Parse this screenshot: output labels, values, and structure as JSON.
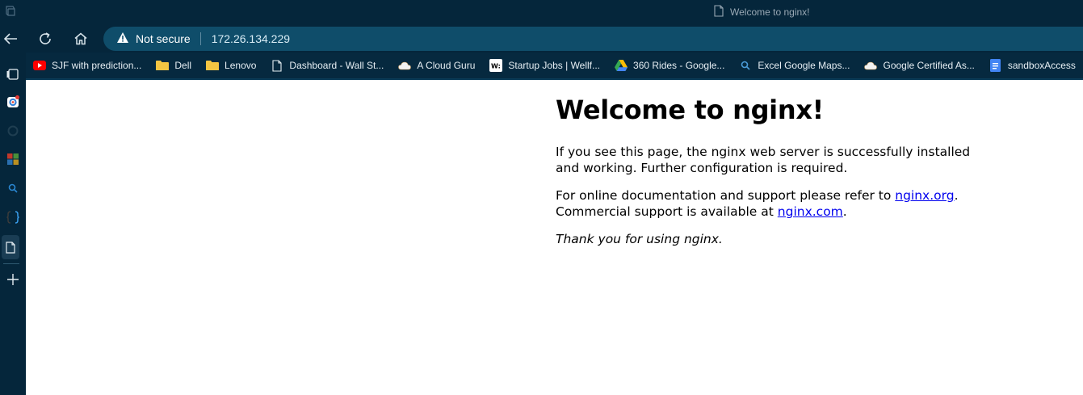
{
  "browser": {
    "tab_title": "Welcome to nginx!",
    "security_label": "Not secure",
    "url": "172.26.134.229"
  },
  "bookmarks": [
    {
      "label": "SJF with prediction...",
      "icon": "youtube-icon",
      "color": "#ff0000"
    },
    {
      "label": "Dell",
      "icon": "folder-icon",
      "color": "#f4c542"
    },
    {
      "label": "Lenovo",
      "icon": "folder-icon",
      "color": "#f4c542"
    },
    {
      "label": "Dashboard - Wall St...",
      "icon": "page-icon",
      "color": "#e6eef3"
    },
    {
      "label": "A Cloud Guru",
      "icon": "cloud-icon",
      "color": "#e6eef3"
    },
    {
      "label": "Startup Jobs | Wellf...",
      "icon": "wellfound-icon",
      "color": "#ffffff"
    },
    {
      "label": "360 Rides - Google...",
      "icon": "google-drive-icon",
      "color": "#34a853"
    },
    {
      "label": "Excel Google Maps...",
      "icon": "search-icon",
      "color": "#4a9bd8"
    },
    {
      "label": "Google Certified As...",
      "icon": "cloud-icon",
      "color": "#e6eef3"
    },
    {
      "label": "sandboxAccess",
      "icon": "google-docs-icon",
      "color": "#4285f4"
    }
  ],
  "page": {
    "heading": "Welcome to nginx!",
    "para1": "If you see this page, the nginx web server is successfully installed and working. Further configuration is required.",
    "para2_prefix": "For online documentation and support please refer to ",
    "link1": "nginx.org",
    "para2_mid": ".",
    "para2_line2": "Commercial support is available at ",
    "link2": "nginx.com",
    "para2_end": ".",
    "thanks": "Thank you for using nginx."
  }
}
